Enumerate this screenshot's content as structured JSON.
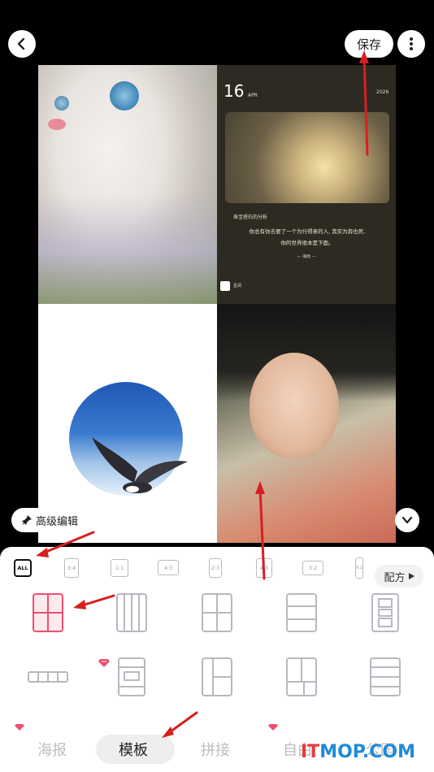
{
  "topbar": {
    "back_icon": "chevron-left-icon",
    "save_label": "保存",
    "more_icon": "more-vertical-icon"
  },
  "collage": {
    "card": {
      "date_day": "16",
      "date_month": "APR",
      "year": "2026",
      "author": "珠宝搭石的分析",
      "quote_line1": "你总有你去要了一个为行得来的人, 其实为奔也死,",
      "quote_line2": "你的世界很本是下面。",
      "signature": "— 海雨 —",
      "brand": "星阅"
    }
  },
  "controls": {
    "advanced_edit_label": "高级编辑",
    "collapse_icon": "chevron-down-icon"
  },
  "ratios": [
    {
      "label": "ALL",
      "selected": true
    },
    {
      "label": "3:4"
    },
    {
      "label": "1:1"
    },
    {
      "label": "4:3"
    },
    {
      "label": "2:3"
    },
    {
      "label": "4:5"
    },
    {
      "label": "3:2"
    },
    {
      "label": "9:1"
    }
  ],
  "formula_label": "配方",
  "tabs": [
    {
      "label": "海报",
      "active": false
    },
    {
      "label": "模板",
      "active": true
    },
    {
      "label": "拼接",
      "active": false
    },
    {
      "label": "自由",
      "active": false
    },
    {
      "label": "公园",
      "active": false
    }
  ],
  "colors": {
    "accent": "#ef4f6f",
    "arrow": "#d71f1f",
    "watermark_blue": "#1e8bd9",
    "watermark_red": "#e93a3a"
  },
  "watermark": {
    "prefix": "IT",
    "rest": "MOP.COM"
  }
}
